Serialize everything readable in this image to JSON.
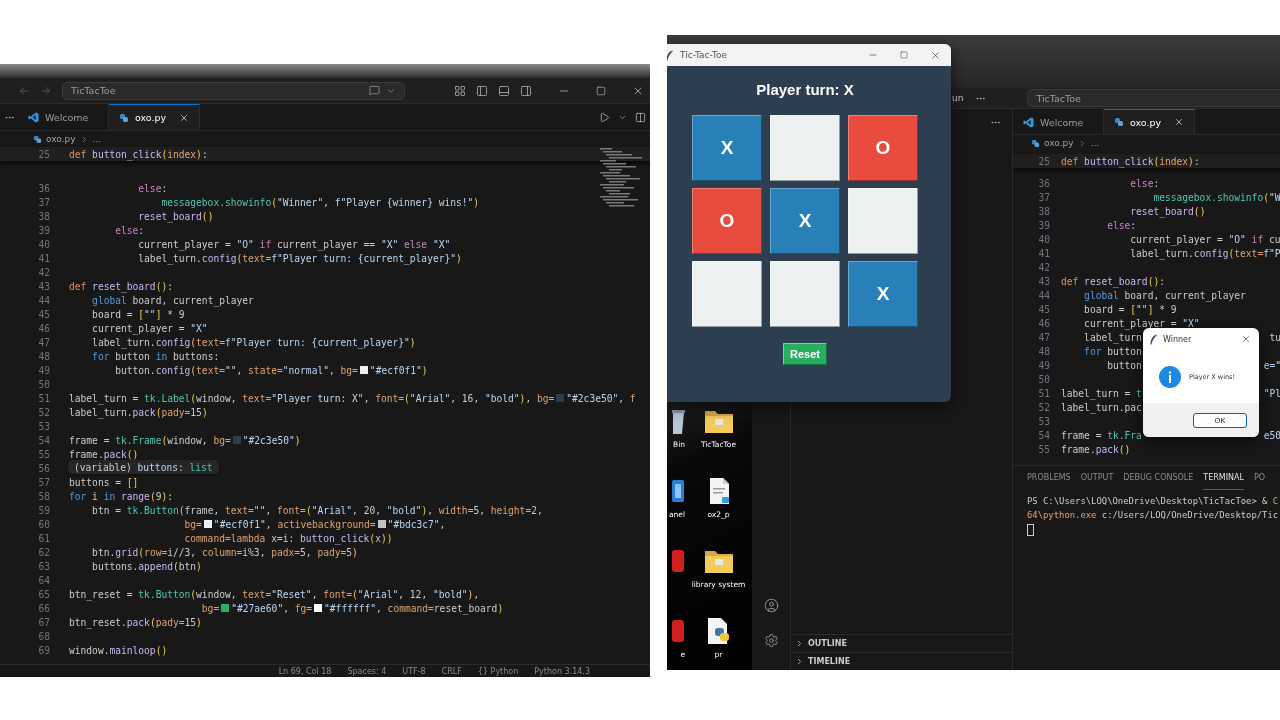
{
  "left_editor": {
    "search": "TicTacToe",
    "tabs": [
      {
        "label": "Welcome",
        "selected": false,
        "kind": "welcome"
      },
      {
        "label": "oxo.py",
        "selected": true,
        "kind": "python"
      }
    ],
    "breadcrumb": [
      "oxo.py",
      "..."
    ],
    "sticky_line": {
      "number": "25",
      "tokens": [
        {
          "kind": "def",
          "text": "def "
        },
        {
          "kind": "fn",
          "text": "button_click"
        },
        {
          "kind": "br",
          "text": "("
        },
        {
          "kind": "param",
          "text": "index"
        },
        {
          "kind": "br",
          "text": ")"
        },
        {
          "kind": "plain",
          "text": ":"
        }
      ]
    },
    "lines": [
      {
        "number": "36",
        "tokens": [
          {
            "kind": "ctl",
            "text": "            else"
          },
          {
            "kind": "plain",
            "text": ":"
          }
        ]
      },
      {
        "number": "37",
        "tokens": [
          {
            "kind": "cls",
            "text": "                messagebox.showinfo"
          },
          {
            "kind": "br",
            "text": "("
          },
          {
            "kind": "str",
            "text": "\"Winner\""
          },
          {
            "kind": "plain",
            "text": ", "
          },
          {
            "kind": "str",
            "text": "f\"Player {winner} wins!\""
          },
          {
            "kind": "br",
            "text": ")"
          }
        ]
      },
      {
        "number": "38",
        "tokens": [
          {
            "kind": "fn",
            "text": "            reset_board"
          },
          {
            "kind": "br",
            "text": "()"
          }
        ]
      },
      {
        "number": "39",
        "tokens": [
          {
            "kind": "ctl",
            "text": "        else"
          },
          {
            "kind": "plain",
            "text": ":"
          }
        ]
      },
      {
        "number": "40",
        "tokens": [
          {
            "kind": "plain",
            "text": "            current_player = "
          },
          {
            "kind": "str",
            "text": "\"O\""
          },
          {
            "kind": "ctl",
            "text": " if "
          },
          {
            "kind": "plain",
            "text": "current_player == "
          },
          {
            "kind": "str",
            "text": "\"X\""
          },
          {
            "kind": "ctl",
            "text": " else "
          },
          {
            "kind": "str",
            "text": "\"X\""
          }
        ]
      },
      {
        "number": "41",
        "tokens": [
          {
            "kind": "plain",
            "text": "            label_turn."
          },
          {
            "kind": "fn",
            "text": "config"
          },
          {
            "kind": "br",
            "text": "("
          },
          {
            "kind": "param",
            "text": "text="
          },
          {
            "kind": "str",
            "text": "f\"Player turn: {current_player}\""
          },
          {
            "kind": "br",
            "text": ")"
          }
        ]
      },
      {
        "number": "42"
      },
      {
        "number": "43",
        "tokens": [
          {
            "kind": "def",
            "text": "def "
          },
          {
            "kind": "fn",
            "text": "reset_board"
          },
          {
            "kind": "br",
            "text": "()"
          },
          {
            "kind": "plain",
            "text": ":"
          }
        ]
      },
      {
        "number": "44",
        "tokens": [
          {
            "kind": "kw",
            "text": "    global"
          },
          {
            "kind": "plain",
            "text": " board, current_player"
          }
        ]
      },
      {
        "number": "45",
        "tokens": [
          {
            "kind": "plain",
            "text": "    board = "
          },
          {
            "kind": "br",
            "text": "["
          },
          {
            "kind": "str",
            "text": "\"\""
          },
          {
            "kind": "br",
            "text": "]"
          },
          {
            "kind": "plain",
            "text": " * 9"
          }
        ]
      },
      {
        "number": "46",
        "tokens": [
          {
            "kind": "plain",
            "text": "    current_player = "
          },
          {
            "kind": "str",
            "text": "\"X\""
          }
        ]
      },
      {
        "number": "47",
        "tokens": [
          {
            "kind": "plain",
            "text": "    label_turn."
          },
          {
            "kind": "fn",
            "text": "config"
          },
          {
            "kind": "br",
            "text": "("
          },
          {
            "kind": "param",
            "text": "text="
          },
          {
            "kind": "str",
            "text": "f\"Player turn: {current_player}\""
          },
          {
            "kind": "br",
            "text": ")"
          }
        ]
      },
      {
        "number": "48",
        "tokens": [
          {
            "kind": "kw",
            "text": "    for"
          },
          {
            "kind": "plain",
            "text": " button "
          },
          {
            "kind": "kw",
            "text": "in"
          },
          {
            "kind": "plain",
            "text": " buttons:"
          }
        ]
      },
      {
        "number": "49",
        "tokens": [
          {
            "kind": "plain",
            "text": "        button."
          },
          {
            "kind": "fn",
            "text": "config"
          },
          {
            "kind": "br",
            "text": "("
          },
          {
            "kind": "param",
            "text": "text="
          },
          {
            "kind": "str",
            "text": "\"\""
          },
          {
            "kind": "plain",
            "text": ", "
          },
          {
            "kind": "param",
            "text": "state="
          },
          {
            "kind": "str",
            "text": "\"normal\""
          },
          {
            "kind": "plain",
            "text": ", "
          },
          {
            "kind": "param",
            "text": "bg="
          },
          {
            "kind": "swatch",
            "color": "#ecf0f1"
          },
          {
            "kind": "str",
            "text": "\"#ecf0f1\""
          },
          {
            "kind": "br",
            "text": ")"
          }
        ]
      },
      {
        "number": "50"
      },
      {
        "number": "51",
        "tokens": [
          {
            "kind": "plain",
            "text": "label_turn = "
          },
          {
            "kind": "cls",
            "text": "tk.Label"
          },
          {
            "kind": "br",
            "text": "("
          },
          {
            "kind": "plain",
            "text": "window, "
          },
          {
            "kind": "param",
            "text": "text="
          },
          {
            "kind": "str",
            "text": "\"Player turn: X\""
          },
          {
            "kind": "plain",
            "text": ", "
          },
          {
            "kind": "param",
            "text": "font="
          },
          {
            "kind": "br",
            "text": "("
          },
          {
            "kind": "str",
            "text": "\"Arial\""
          },
          {
            "kind": "plain",
            "text": ", 16, "
          },
          {
            "kind": "str",
            "text": "\"bold\""
          },
          {
            "kind": "br",
            "text": ")"
          },
          {
            "kind": "plain",
            "text": ", "
          },
          {
            "kind": "param",
            "text": "bg="
          },
          {
            "kind": "swatch",
            "color": "#2c3e50"
          },
          {
            "kind": "str",
            "text": "\"#2c3e50\", "
          },
          {
            "kind": "param",
            "text": "f"
          }
        ]
      },
      {
        "number": "52",
        "tokens": [
          {
            "kind": "plain",
            "text": "label_turn."
          },
          {
            "kind": "fn",
            "text": "pack"
          },
          {
            "kind": "br",
            "text": "("
          },
          {
            "kind": "param",
            "text": "pady="
          },
          {
            "kind": "plain",
            "text": "15"
          },
          {
            "kind": "br",
            "text": ")"
          }
        ]
      },
      {
        "number": "53"
      },
      {
        "number": "54",
        "tokens": [
          {
            "kind": "plain",
            "text": "frame = "
          },
          {
            "kind": "cls",
            "text": "tk.Frame"
          },
          {
            "kind": "br",
            "text": "("
          },
          {
            "kind": "plain",
            "text": "window, "
          },
          {
            "kind": "param",
            "text": "bg="
          },
          {
            "kind": "swatch",
            "color": "#2c3e50"
          },
          {
            "kind": "str",
            "text": "\"#2c3e50\""
          },
          {
            "kind": "br",
            "text": ")"
          }
        ]
      },
      {
        "number": "55",
        "tokens": [
          {
            "kind": "plain",
            "text": "frame."
          },
          {
            "kind": "fn",
            "text": "pack"
          },
          {
            "kind": "br",
            "text": "()"
          }
        ]
      },
      {
        "number": "56"
      },
      {
        "number": "57",
        "tokens": [
          {
            "kind": "plain",
            "text": "buttons = "
          },
          {
            "kind": "br",
            "text": "[]"
          }
        ]
      },
      {
        "number": "58",
        "tokens": [
          {
            "kind": "kw",
            "text": "for"
          },
          {
            "kind": "plain",
            "text": " i "
          },
          {
            "kind": "kw",
            "text": "in"
          },
          {
            "kind": "fn",
            "text": " range"
          },
          {
            "kind": "br",
            "text": "("
          },
          {
            "kind": "plain",
            "text": "9"
          },
          {
            "kind": "br",
            "text": ")"
          },
          {
            "kind": "plain",
            "text": ":"
          }
        ]
      },
      {
        "number": "59",
        "tokens": [
          {
            "kind": "plain",
            "text": "    btn = "
          },
          {
            "kind": "cls",
            "text": "tk.Button"
          },
          {
            "kind": "br",
            "text": "("
          },
          {
            "kind": "plain",
            "text": "frame, "
          },
          {
            "kind": "param",
            "text": "text="
          },
          {
            "kind": "str",
            "text": "\"\""
          },
          {
            "kind": "plain",
            "text": ", "
          },
          {
            "kind": "param",
            "text": "font="
          },
          {
            "kind": "br",
            "text": "("
          },
          {
            "kind": "str",
            "text": "\"Arial\""
          },
          {
            "kind": "plain",
            "text": ", 20, "
          },
          {
            "kind": "str",
            "text": "\"bold\""
          },
          {
            "kind": "br",
            "text": ")"
          },
          {
            "kind": "plain",
            "text": ", "
          },
          {
            "kind": "param",
            "text": "width="
          },
          {
            "kind": "plain",
            "text": "5, "
          },
          {
            "kind": "param",
            "text": "height="
          },
          {
            "kind": "plain",
            "text": "2,"
          }
        ]
      },
      {
        "number": "60",
        "tokens": [
          {
            "kind": "param",
            "text": "                    bg="
          },
          {
            "kind": "swatch",
            "color": "#ecf0f1"
          },
          {
            "kind": "str",
            "text": "\"#ecf0f1\""
          },
          {
            "kind": "plain",
            "text": ", "
          },
          {
            "kind": "param",
            "text": "activebackground="
          },
          {
            "kind": "swatch",
            "color": "#bdc3c7"
          },
          {
            "kind": "str",
            "text": "\"#bdc3c7\""
          },
          {
            "kind": "plain",
            "text": ","
          }
        ]
      },
      {
        "number": "61",
        "tokens": [
          {
            "kind": "param",
            "text": "                    command=lambda"
          },
          {
            "kind": "plain",
            "text": " x=i: "
          },
          {
            "kind": "fn",
            "text": "button_click"
          },
          {
            "kind": "br",
            "text": "("
          },
          {
            "kind": "plain",
            "text": "x"
          },
          {
            "kind": "br",
            "text": "))"
          }
        ]
      },
      {
        "number": "62",
        "tokens": [
          {
            "kind": "plain",
            "text": "    btn."
          },
          {
            "kind": "fn",
            "text": "grid"
          },
          {
            "kind": "br",
            "text": "("
          },
          {
            "kind": "param",
            "text": "row="
          },
          {
            "kind": "plain",
            "text": "i//3, "
          },
          {
            "kind": "param",
            "text": "column="
          },
          {
            "kind": "plain",
            "text": "i%3, "
          },
          {
            "kind": "param",
            "text": "padx="
          },
          {
            "kind": "plain",
            "text": "5, "
          },
          {
            "kind": "param",
            "text": "pady="
          },
          {
            "kind": "plain",
            "text": "5"
          },
          {
            "kind": "br",
            "text": ")"
          }
        ]
      },
      {
        "number": "63",
        "tokens": [
          {
            "kind": "plain",
            "text": "    buttons."
          },
          {
            "kind": "fn",
            "text": "append"
          },
          {
            "kind": "br",
            "text": "("
          },
          {
            "kind": "plain",
            "text": "btn"
          },
          {
            "kind": "br",
            "text": ")"
          }
        ]
      },
      {
        "number": "64"
      },
      {
        "number": "65",
        "tokens": [
          {
            "kind": "plain",
            "text": "btn_reset = "
          },
          {
            "kind": "cls",
            "text": "tk.Button"
          },
          {
            "kind": "br",
            "text": "("
          },
          {
            "kind": "plain",
            "text": "window, "
          },
          {
            "kind": "param",
            "text": "text="
          },
          {
            "kind": "str",
            "text": "\"Reset\""
          },
          {
            "kind": "plain",
            "text": ", "
          },
          {
            "kind": "param",
            "text": "font="
          },
          {
            "kind": "br",
            "text": "("
          },
          {
            "kind": "str",
            "text": "\"Arial\""
          },
          {
            "kind": "plain",
            "text": ", 12, "
          },
          {
            "kind": "str",
            "text": "\"bold\""
          },
          {
            "kind": "br",
            "text": ")"
          },
          {
            "kind": "plain",
            "text": ","
          }
        ]
      },
      {
        "number": "66",
        "tokens": [
          {
            "kind": "param",
            "text": "                       bg="
          },
          {
            "kind": "swatch",
            "color": "#27ae60"
          },
          {
            "kind": "str",
            "text": "\"#27ae60\""
          },
          {
            "kind": "plain",
            "text": ", "
          },
          {
            "kind": "param",
            "text": "fg="
          },
          {
            "kind": "swatch",
            "color": "#ffffff"
          },
          {
            "kind": "str",
            "text": "\"#ffffff\""
          },
          {
            "kind": "plain",
            "text": ", "
          },
          {
            "kind": "param",
            "text": "command="
          },
          {
            "kind": "plain",
            "text": "reset_board"
          },
          {
            "kind": "br",
            "text": ")"
          }
        ]
      },
      {
        "number": "67",
        "tokens": [
          {
            "kind": "plain",
            "text": "btn_reset."
          },
          {
            "kind": "fn",
            "text": "pack"
          },
          {
            "kind": "br",
            "text": "("
          },
          {
            "kind": "param",
            "text": "pady="
          },
          {
            "kind": "plain",
            "text": "15"
          },
          {
            "kind": "br",
            "text": ")"
          }
        ]
      },
      {
        "number": "68"
      },
      {
        "number": "69",
        "tokens": [
          {
            "kind": "plain",
            "text": "window."
          },
          {
            "kind": "fn",
            "text": "mainloop"
          },
          {
            "kind": "br",
            "text": "()"
          }
        ]
      }
    ],
    "tooltip": [
      {
        "kind": "plain",
        "text": "(variable) "
      },
      {
        "kind": "str",
        "text": "buttons"
      },
      {
        "kind": "plain",
        "text": ": "
      },
      {
        "kind": "cls",
        "text": "list"
      }
    ],
    "status": [
      "Ln 69, Col 18",
      "Spaces: 4",
      "UTF-8",
      "CRLF",
      "{} Python",
      "Python 3.14.3"
    ]
  },
  "right": {
    "desktop_icons": [
      {
        "label": "Bin",
        "kind": "bin"
      },
      {
        "label": "TicTacToe",
        "kind": "folder"
      },
      {
        "label": "anel",
        "kind": "blue-app"
      },
      {
        "label": "ox2_p",
        "kind": "document"
      },
      {
        "kind": "red-app"
      },
      {
        "label": "library system",
        "kind": "folder"
      },
      {
        "label": "e",
        "kind": "red-app"
      },
      {
        "label": "pr",
        "kind": "python"
      }
    ],
    "vscode": {
      "menu_fragment": "un",
      "search": "TicTacToe",
      "tabs": [
        {
          "label": "Welcome",
          "selected": false,
          "kind": "welcome"
        },
        {
          "label": "oxo.py",
          "selected": true,
          "kind": "python"
        }
      ],
      "breadcrumb": [
        "oxo.py",
        "..."
      ],
      "sticky_line": {
        "number": "25",
        "tokens": [
          {
            "kind": "def",
            "text": "def "
          },
          {
            "kind": "fn",
            "text": "button_click"
          },
          {
            "kind": "br",
            "text": "("
          },
          {
            "kind": "param",
            "text": "index"
          },
          {
            "kind": "br",
            "text": ")"
          },
          {
            "kind": "plain",
            "text": ":"
          }
        ]
      },
      "lines": [
        {
          "number": "36",
          "tokens": [
            {
              "kind": "ctl",
              "text": "            else"
            },
            {
              "kind": "plain",
              "text": ":"
            }
          ]
        },
        {
          "number": "37",
          "tokens": [
            {
              "kind": "cls",
              "text": "                messagebox.showinfo"
            },
            {
              "kind": "br",
              "text": "("
            },
            {
              "kind": "str",
              "text": "\"W"
            }
          ]
        },
        {
          "number": "38",
          "tokens": [
            {
              "kind": "fn",
              "text": "            reset_board"
            },
            {
              "kind": "br",
              "text": "()"
            }
          ]
        },
        {
          "number": "39",
          "tokens": [
            {
              "kind": "ctl",
              "text": "        else"
            },
            {
              "kind": "plain",
              "text": ":"
            }
          ]
        },
        {
          "number": "40",
          "tokens": [
            {
              "kind": "plain",
              "text": "            current_player = "
            },
            {
              "kind": "str",
              "text": "\"O\""
            },
            {
              "kind": "ctl",
              "text": " if "
            },
            {
              "kind": "plain",
              "text": "cu"
            }
          ]
        },
        {
          "number": "41",
          "tokens": [
            {
              "kind": "plain",
              "text": "            label_turn."
            },
            {
              "kind": "fn",
              "text": "config"
            },
            {
              "kind": "br",
              "text": "("
            },
            {
              "kind": "param",
              "text": "text="
            },
            {
              "kind": "str",
              "text": "f\"P"
            }
          ]
        },
        {
          "number": "42"
        },
        {
          "number": "43",
          "tokens": [
            {
              "kind": "def",
              "text": "def "
            },
            {
              "kind": "fn",
              "text": "reset_board"
            },
            {
              "kind": "br",
              "text": "()"
            },
            {
              "kind": "plain",
              "text": ":"
            }
          ]
        },
        {
          "number": "44",
          "tokens": [
            {
              "kind": "kw",
              "text": "    global"
            },
            {
              "kind": "plain",
              "text": " board, current_player"
            }
          ]
        },
        {
          "number": "45",
          "tokens": [
            {
              "kind": "plain",
              "text": "    board = "
            },
            {
              "kind": "br",
              "text": "["
            },
            {
              "kind": "str",
              "text": "\"\""
            },
            {
              "kind": "br",
              "text": "]"
            },
            {
              "kind": "plain",
              "text": " * 9"
            }
          ]
        },
        {
          "number": "46",
          "tokens": [
            {
              "kind": "plain",
              "text": "    current_player = "
            },
            {
              "kind": "str",
              "text": "\"X\""
            }
          ]
        },
        {
          "number": "47",
          "tokens": [
            {
              "kind": "plain",
              "text": "    label_turn"
            }
          ],
          "tail": [
            {
              "kind": "plain",
              "text": "tu"
            }
          ]
        },
        {
          "number": "48",
          "tokens": [
            {
              "kind": "kw",
              "text": "    for"
            },
            {
              "kind": "plain",
              "text": " button"
            }
          ]
        },
        {
          "number": "49",
          "tokens": [
            {
              "kind": "plain",
              "text": "        button"
            }
          ],
          "tail": [
            {
              "kind": "str",
              "text": "e=\""
            }
          ]
        },
        {
          "number": "50"
        },
        {
          "number": "51",
          "tokens": [
            {
              "kind": "plain",
              "text": "label_turn = "
            },
            {
              "kind": "cls",
              "text": "t"
            }
          ],
          "tail": [
            {
              "kind": "str",
              "text": "\"Pl"
            }
          ]
        },
        {
          "number": "52",
          "tokens": [
            {
              "kind": "plain",
              "text": "label_turn.pac"
            }
          ]
        },
        {
          "number": "53"
        },
        {
          "number": "54",
          "tokens": [
            {
              "kind": "plain",
              "text": "frame = "
            },
            {
              "kind": "cls",
              "text": "tk.Fra"
            }
          ],
          "tail": [
            {
              "kind": "str",
              "text": "e50"
            }
          ]
        },
        {
          "number": "55",
          "tokens": [
            {
              "kind": "plain",
              "text": "frame."
            },
            {
              "kind": "fn",
              "text": "pack"
            },
            {
              "kind": "br",
              "text": "()"
            }
          ]
        }
      ],
      "panel_tabs": [
        {
          "label": "PROBLEMS",
          "selected": false
        },
        {
          "label": "OUTPUT",
          "selected": false
        },
        {
          "label": "DEBUG CONSOLE",
          "selected": false
        },
        {
          "label": "TERMINAL",
          "selected": true
        },
        {
          "label": "PO",
          "selected": false
        }
      ],
      "terminal": [
        [
          {
            "kind": "plain",
            "text": "PS C:\\Users\\LOQ\\OneDrive\\Desktop\\TicTacToe> & "
          },
          {
            "kind": "param",
            "text": "C"
          }
        ],
        [
          {
            "kind": "param",
            "text": "64\\python.exe"
          },
          {
            "kind": "plain",
            "text": " c:/Users/LOQ/OneDrive/Desktop/Tic"
          }
        ]
      ],
      "sidebar_sections": [
        "OUTLINE",
        "TIMELINE"
      ]
    },
    "tictactoe": {
      "title": "Tic-Tac-Toe",
      "turn": "Player turn: X",
      "cells": [
        {
          "text": "X",
          "color": "#2980b9"
        },
        {
          "color": "#ecf0f1"
        },
        {
          "text": "O",
          "color": "#e74c3c"
        },
        {
          "text": "O",
          "color": "#e74c3c"
        },
        {
          "text": "X",
          "color": "#2980b9"
        },
        {
          "color": "#ecf0f1"
        },
        {
          "color": "#ecf0f1"
        },
        {
          "color": "#ecf0f1"
        },
        {
          "text": "X",
          "color": "#2980b9"
        }
      ],
      "reset": "Reset"
    },
    "dialog": {
      "title": "Winner",
      "message": "Player X wins!",
      "button": "OK"
    }
  }
}
